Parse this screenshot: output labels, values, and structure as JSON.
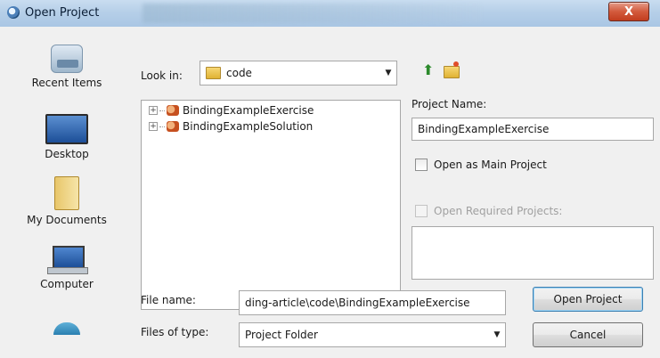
{
  "window": {
    "title": "Open Project",
    "close_label": "X"
  },
  "places": [
    {
      "label": "Recent Items",
      "icon": "recent-items-icon"
    },
    {
      "label": "Desktop",
      "icon": "desktop-icon"
    },
    {
      "label": "My Documents",
      "icon": "my-documents-icon"
    },
    {
      "label": "Computer",
      "icon": "computer-icon"
    },
    {
      "label": "",
      "icon": "network-icon"
    }
  ],
  "lookin": {
    "label": "Look in:",
    "value": "code"
  },
  "tree": [
    {
      "label": "BindingExampleExercise",
      "expander": "+"
    },
    {
      "label": "BindingExampleSolution",
      "expander": "+"
    }
  ],
  "project_name": {
    "label": "Project Name:",
    "value": "BindingExampleExercise"
  },
  "open_as_main": {
    "label": "Open as Main Project",
    "checked": false
  },
  "open_required": {
    "label": "Open Required Projects:",
    "checked": false,
    "enabled": false
  },
  "file_name": {
    "label": "File name:",
    "value": "ding-article\\code\\BindingExampleExercise"
  },
  "file_type": {
    "label": "Files of type:",
    "value": "Project Folder"
  },
  "buttons": {
    "open": "Open Project",
    "cancel": "Cancel"
  }
}
